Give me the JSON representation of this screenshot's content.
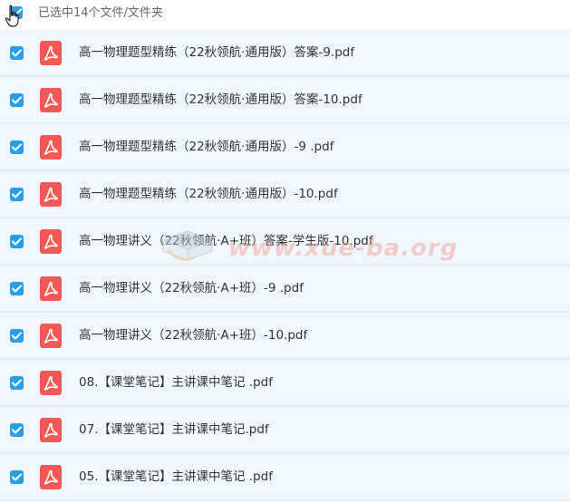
{
  "header": {
    "selection_text": "已选中14个文件/文件夹"
  },
  "files": [
    {
      "name": "高一物理题型精练（22秋领航·通用版）答案-9.pdf",
      "checked": true
    },
    {
      "name": "高一物理题型精练（22秋领航·通用版）答案-10.pdf",
      "checked": true
    },
    {
      "name": "高一物理题型精练（22秋领航·通用版）-9 .pdf",
      "checked": true
    },
    {
      "name": "高一物理题型精练（22秋领航·通用版）-10.pdf",
      "checked": true
    },
    {
      "name": "高一物理讲义（22秋领航·A+班）答案-学生版-10.pdf",
      "checked": true
    },
    {
      "name": "高一物理讲义（22秋领航·A+班）-9 .pdf",
      "checked": true
    },
    {
      "name": "高一物理讲义（22秋领航·A+班）-10.pdf",
      "checked": true
    },
    {
      "name": "08.【课堂笔记】主讲课中笔记 .pdf",
      "checked": true
    },
    {
      "name": "07.【课堂笔记】主讲课中笔记.pdf",
      "checked": true
    },
    {
      "name": "05.【课堂笔记】主讲课中笔记 .pdf",
      "checked": true
    }
  ],
  "watermark": {
    "text": "www.xue-ba.org"
  },
  "colors": {
    "checkbox": "#2a9fe8",
    "pdf_icon": "#f25b55",
    "row_background": "#f1f8fd",
    "row_divider": "#dcedf8"
  },
  "icons": {
    "file": "pdf-icon",
    "check": "checkmark-icon",
    "cursor": "hand-pointer-icon"
  }
}
